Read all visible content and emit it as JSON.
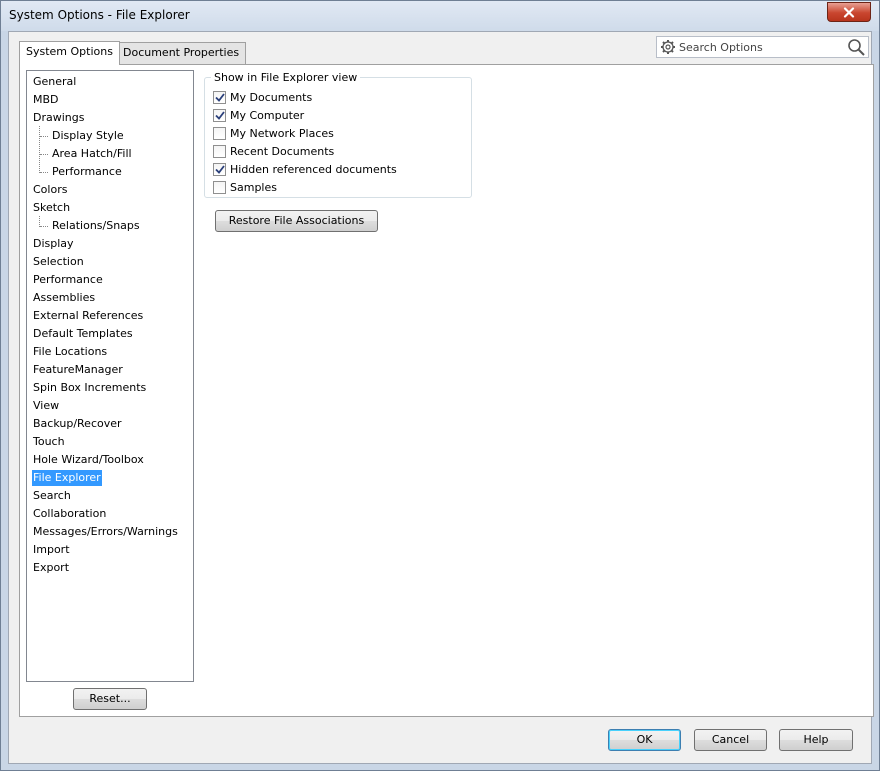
{
  "window": {
    "title": "System Options - File Explorer"
  },
  "tabs": [
    {
      "label": "System Options"
    },
    {
      "label": "Document Properties"
    }
  ],
  "search": {
    "placeholder": "Search Options"
  },
  "tree": [
    {
      "label": "General",
      "level": 0
    },
    {
      "label": "MBD",
      "level": 0
    },
    {
      "label": "Drawings",
      "level": 0
    },
    {
      "label": "Display Style",
      "level": 1
    },
    {
      "label": "Area Hatch/Fill",
      "level": 1
    },
    {
      "label": "Performance",
      "level": 1
    },
    {
      "label": "Colors",
      "level": 0
    },
    {
      "label": "Sketch",
      "level": 0
    },
    {
      "label": "Relations/Snaps",
      "level": 1
    },
    {
      "label": "Display",
      "level": 0
    },
    {
      "label": "Selection",
      "level": 0
    },
    {
      "label": "Performance",
      "level": 0
    },
    {
      "label": "Assemblies",
      "level": 0
    },
    {
      "label": "External References",
      "level": 0
    },
    {
      "label": "Default Templates",
      "level": 0
    },
    {
      "label": "File Locations",
      "level": 0
    },
    {
      "label": "FeatureManager",
      "level": 0
    },
    {
      "label": "Spin Box Increments",
      "level": 0
    },
    {
      "label": "View",
      "level": 0
    },
    {
      "label": "Backup/Recover",
      "level": 0
    },
    {
      "label": "Touch",
      "level": 0
    },
    {
      "label": "Hole Wizard/Toolbox",
      "level": 0
    },
    {
      "label": "File Explorer",
      "level": 0,
      "selected": true
    },
    {
      "label": "Search",
      "level": 0
    },
    {
      "label": "Collaboration",
      "level": 0
    },
    {
      "label": "Messages/Errors/Warnings",
      "level": 0
    },
    {
      "label": "Import",
      "level": 0
    },
    {
      "label": "Export",
      "level": 0
    }
  ],
  "group": {
    "title": "Show in File Explorer view",
    "options": [
      {
        "label": "My Documents",
        "checked": true
      },
      {
        "label": "My Computer",
        "checked": true
      },
      {
        "label": "My Network Places",
        "checked": false
      },
      {
        "label": "Recent Documents",
        "checked": false
      },
      {
        "label": "Hidden referenced documents",
        "checked": true
      },
      {
        "label": "Samples",
        "checked": false
      }
    ]
  },
  "buttons": {
    "restore": "Restore File Associations",
    "reset": "Reset...",
    "ok": "OK",
    "cancel": "Cancel",
    "help": "Help"
  },
  "colors": {
    "selection": "#3399ff",
    "close_button": "#c9462f"
  }
}
